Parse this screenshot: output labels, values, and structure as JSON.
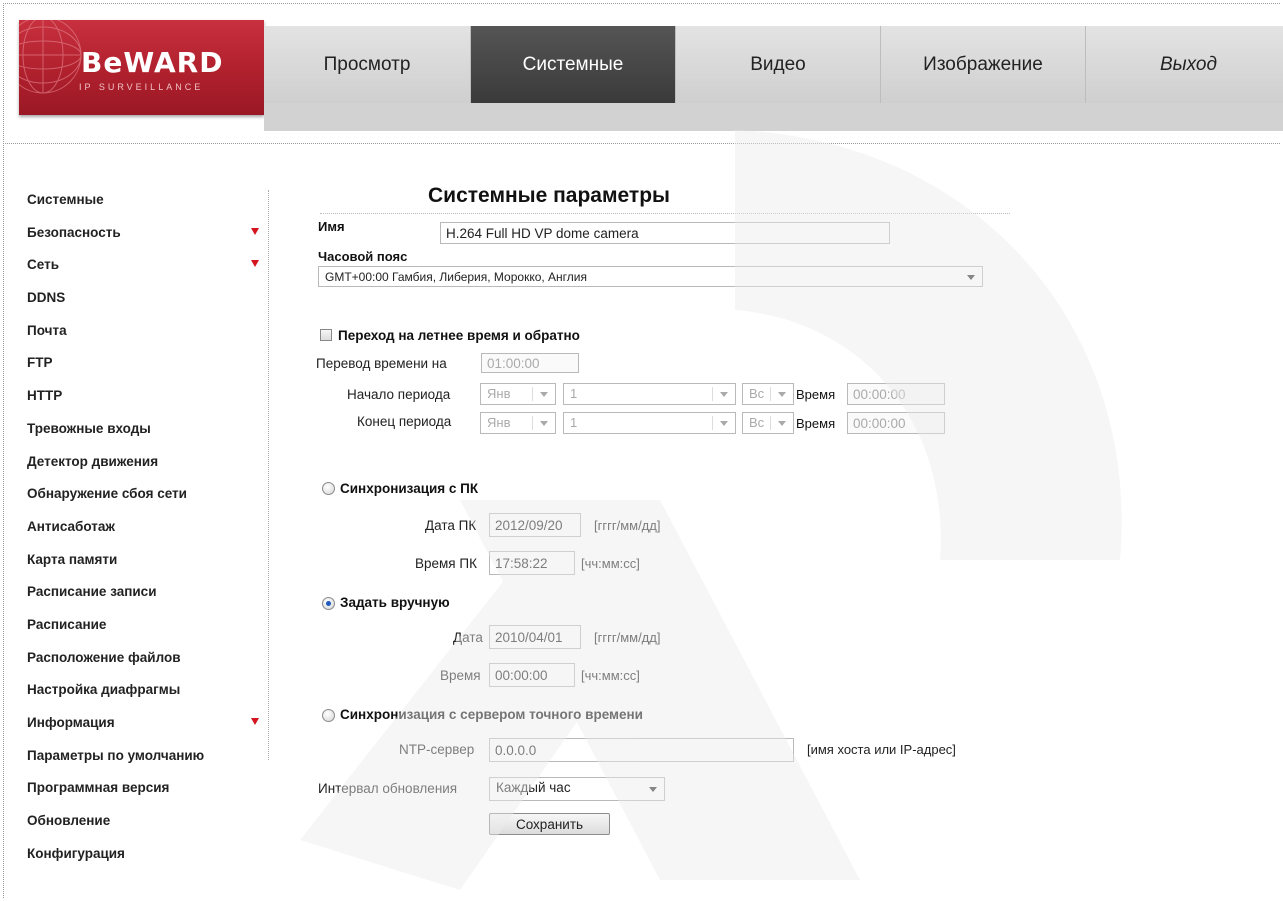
{
  "brand": {
    "name": "BeWARD",
    "tagline": "IP SURVEILLANCE"
  },
  "nav": {
    "tabs": [
      {
        "label": "Просмотр",
        "active": false
      },
      {
        "label": "Системные",
        "active": true
      },
      {
        "label": "Видео",
        "active": false
      },
      {
        "label": "Изображение",
        "active": false
      },
      {
        "label": "Выход",
        "active": false
      }
    ]
  },
  "sidebar": {
    "items": [
      {
        "label": "Системные"
      },
      {
        "label": "Безопасность",
        "expandable": true
      },
      {
        "label": "Сеть",
        "expandable": true
      },
      {
        "label": "DDNS"
      },
      {
        "label": "Почта"
      },
      {
        "label": "FTP"
      },
      {
        "label": "HTTP"
      },
      {
        "label": "Тревожные входы"
      },
      {
        "label": "Детектор движения"
      },
      {
        "label": "Обнаружение сбоя сети"
      },
      {
        "label": "Антисаботаж"
      },
      {
        "label": "Карта памяти"
      },
      {
        "label": "Расписание записи"
      },
      {
        "label": "Расписание"
      },
      {
        "label": "Расположение файлов"
      },
      {
        "label": "Настройка диафрагмы"
      },
      {
        "label": "Информация",
        "expandable": true
      },
      {
        "label": "Параметры по умолчанию"
      },
      {
        "label": "Программная версия"
      },
      {
        "label": "Обновление"
      },
      {
        "label": "Конфигурация"
      }
    ]
  },
  "main": {
    "title": "Системные параметры",
    "name_label": "Имя",
    "name_value": "H.264 Full HD VP dome camera",
    "timezone_label": "Часовой пояс",
    "timezone_value": "GMT+00:00 Гамбия, Либерия, Морокко, Англия",
    "dst": {
      "checkbox_label": "Переход на летнее время и обратно",
      "checked": false,
      "shift_label": "Перевод времени на",
      "shift_value": "01:00:00",
      "start_label": "Начало периода",
      "end_label": "Конец периода",
      "month_value": "Янв",
      "week_value": "1",
      "day_value": "Вс",
      "time_label": "Время",
      "time_value": "00:00:00"
    },
    "sync_pc": {
      "label": "Синхронизация с ПК",
      "selected": false,
      "date_label": "Дата ПК",
      "date_value": "2012/09/20",
      "date_hint": "[гггг/мм/дд]",
      "time_label": "Время ПК",
      "time_value": "17:58:22",
      "time_hint": "[чч:мм:сс]"
    },
    "manual": {
      "label": "Задать вручную",
      "selected": true,
      "date_label": "Дата",
      "date_value": "2010/04/01",
      "date_hint": "[гггг/мм/дд]",
      "time_label": "Время",
      "time_value": "00:00:00",
      "time_hint": "[чч:мм:сс]"
    },
    "ntp": {
      "label": "Синхронизация с сервером точного времени",
      "selected": false,
      "server_label": "NTP-сервер",
      "server_value": "0.0.0.0",
      "server_hint": "[имя хоста или IP-адрес]",
      "interval_label": "Интервал обновления",
      "interval_value": "Каждый час"
    },
    "save_label": "Сохранить"
  },
  "colors": {
    "brand_red": "#b0202d",
    "active_tab": "#454545",
    "nav_bg": "#d9d9d9",
    "arrow_red": "#d4141e"
  }
}
